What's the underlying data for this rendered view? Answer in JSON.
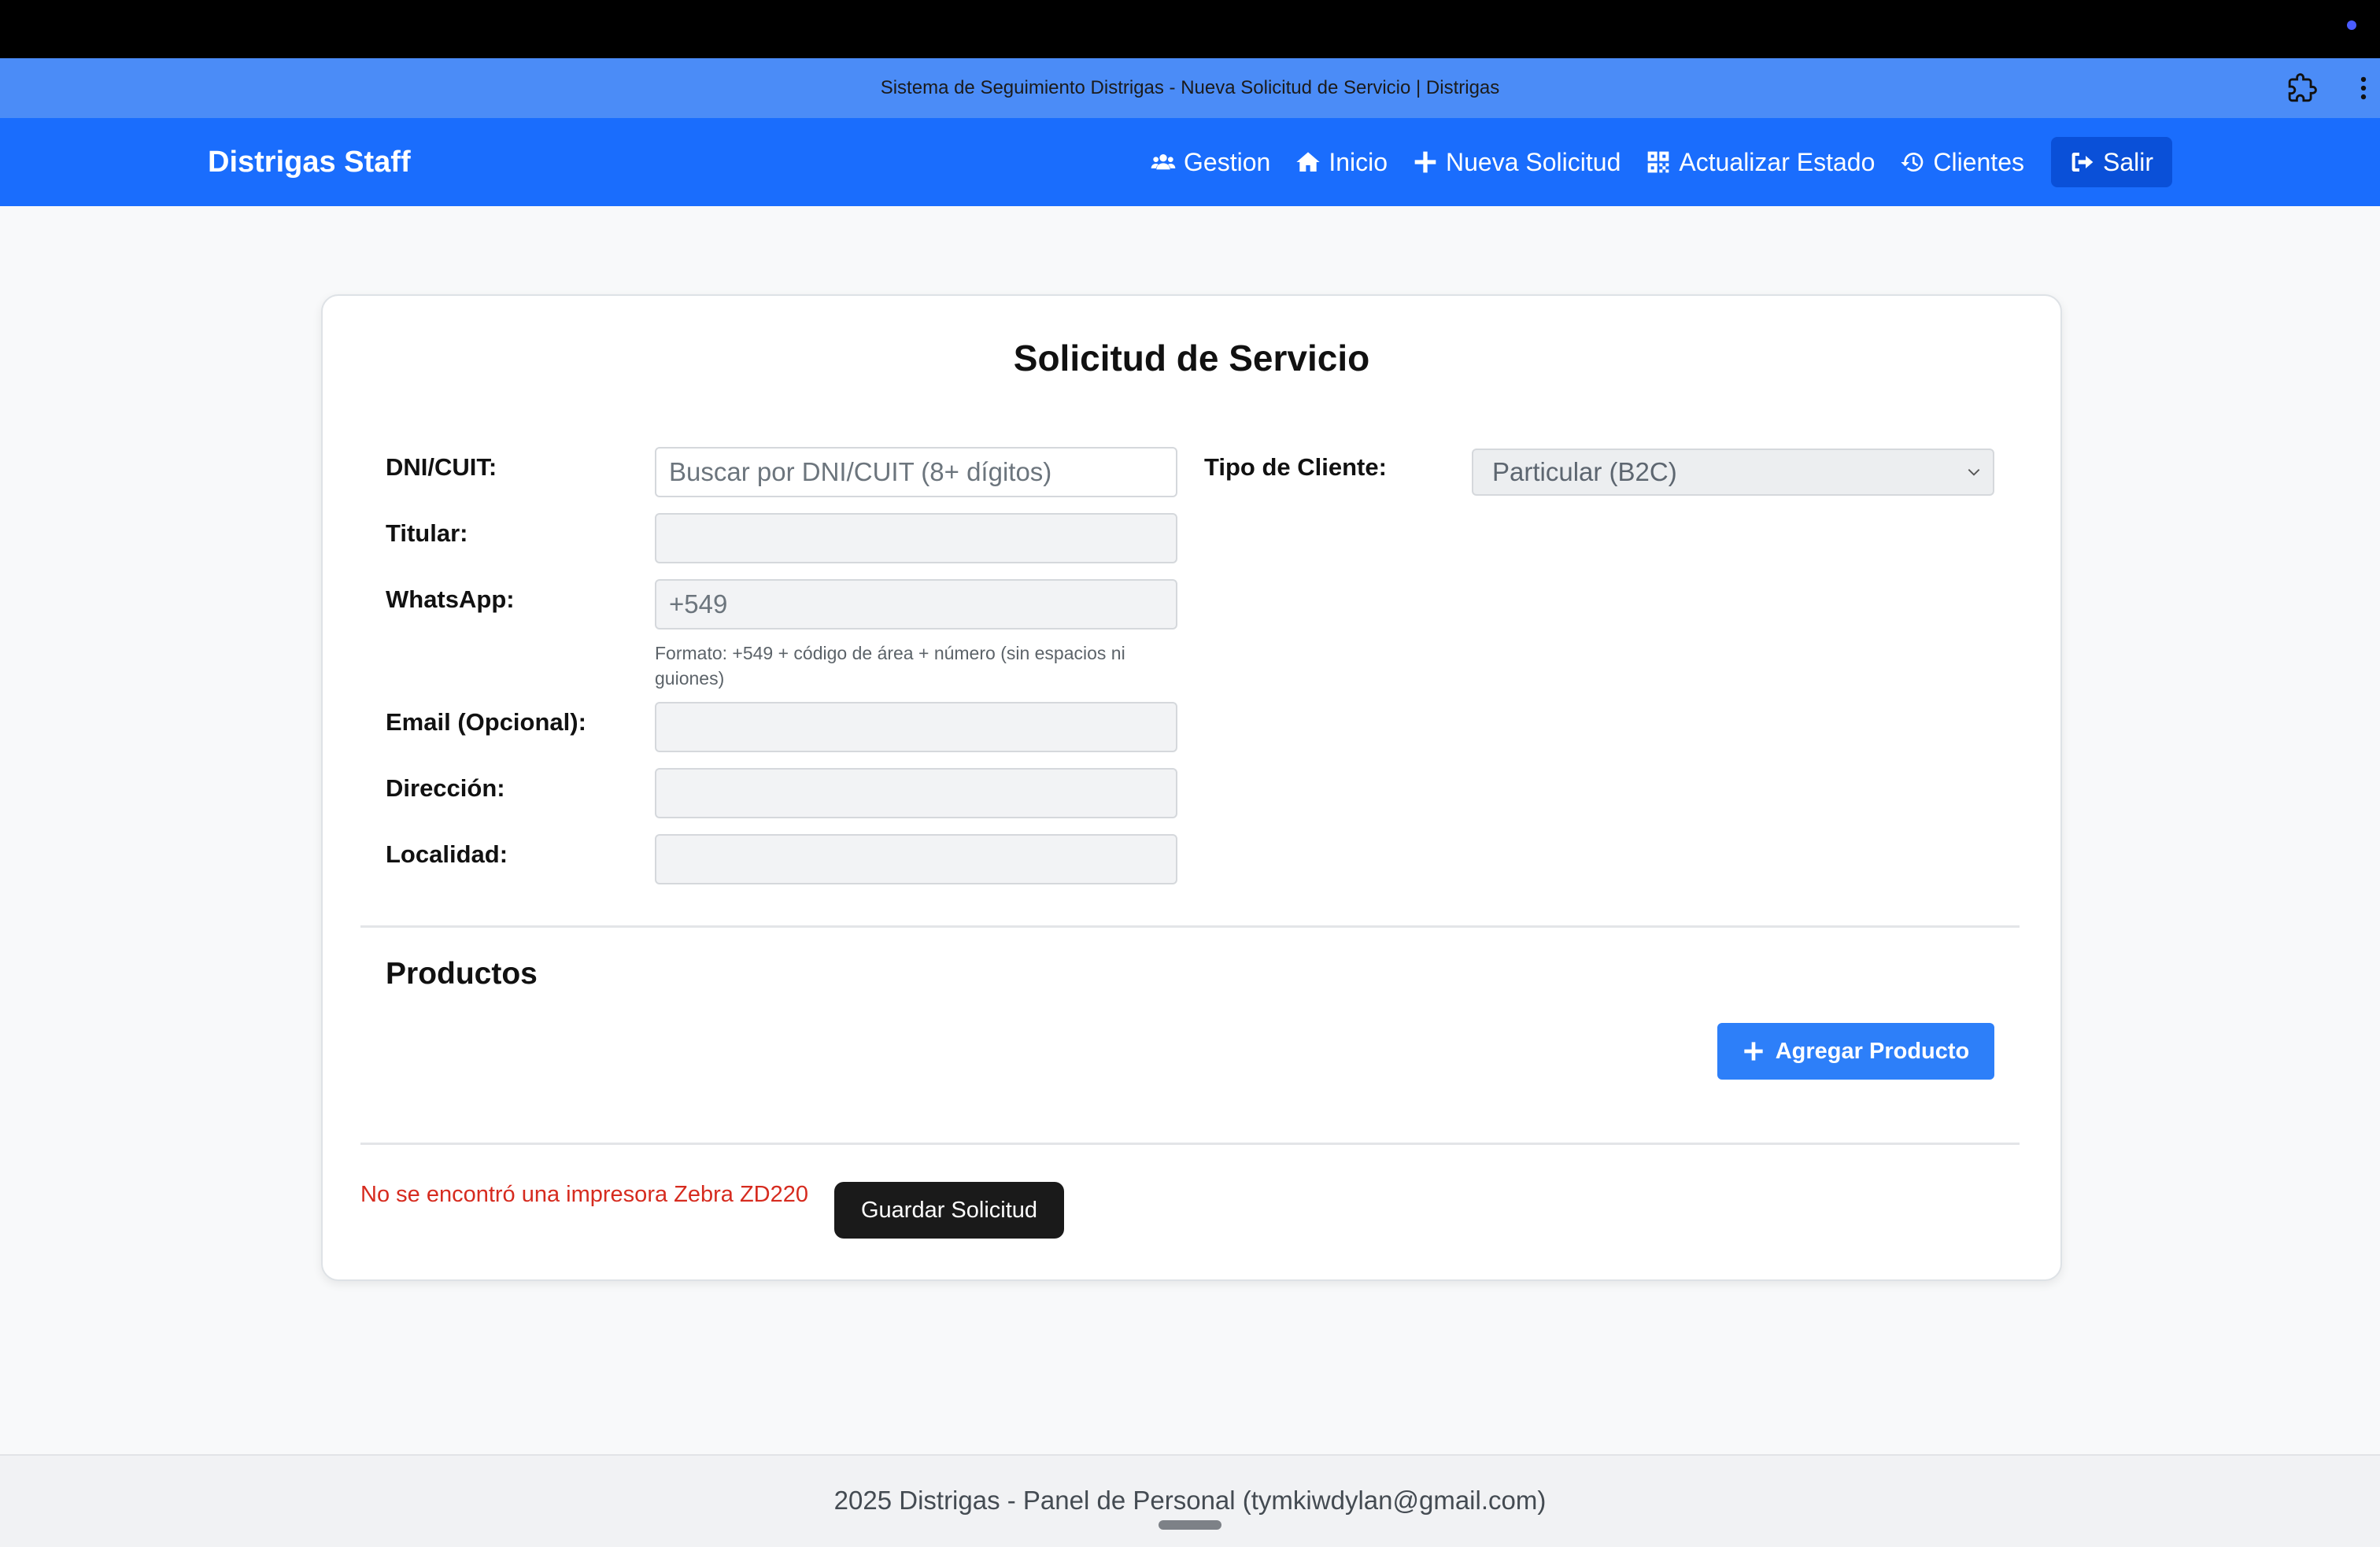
{
  "browser": {
    "title": "Sistema de Seguimiento Distrigas - Nueva Solicitud de Servicio | Distrigas"
  },
  "navbar": {
    "brand": "Distrigas Staff",
    "items": [
      {
        "label": "Gestion",
        "icon": "users-icon"
      },
      {
        "label": "Inicio",
        "icon": "home-icon"
      },
      {
        "label": "Nueva Solicitud",
        "icon": "plus-icon"
      },
      {
        "label": "Actualizar Estado",
        "icon": "qrcode-icon"
      },
      {
        "label": "Clientes",
        "icon": "history-icon"
      },
      {
        "label": "Salir",
        "icon": "sign-out-icon"
      }
    ]
  },
  "form": {
    "title": "Solicitud de Servicio",
    "dni_label": "DNI/CUIT:",
    "dni_placeholder": "Buscar por DNI/CUIT (8+ dígitos)",
    "titular_label": "Titular:",
    "whatsapp_label": "WhatsApp:",
    "whatsapp_value": "+549",
    "whatsapp_help": "Formato: +549 + código de área + número (sin espacios ni guiones)",
    "email_label": "Email (Opcional):",
    "direccion_label": "Dirección:",
    "localidad_label": "Localidad:",
    "tipo_label": "Tipo de Cliente:",
    "tipo_value": "Particular (B2C)"
  },
  "products": {
    "title": "Productos",
    "add_label": "Agregar Producto"
  },
  "actions": {
    "error": "No se encontró una impresora Zebra ZD220",
    "save_label": "Guardar Solicitud"
  },
  "footer": {
    "text": "2025 Distrigas - Panel de Personal (tymkiwdylan@gmail.com)"
  },
  "colors": {
    "navbar": "#1a6dfd",
    "primary_button": "#2d7ff9",
    "error": "#d62b1f",
    "dark_button": "#1a1a1a"
  }
}
